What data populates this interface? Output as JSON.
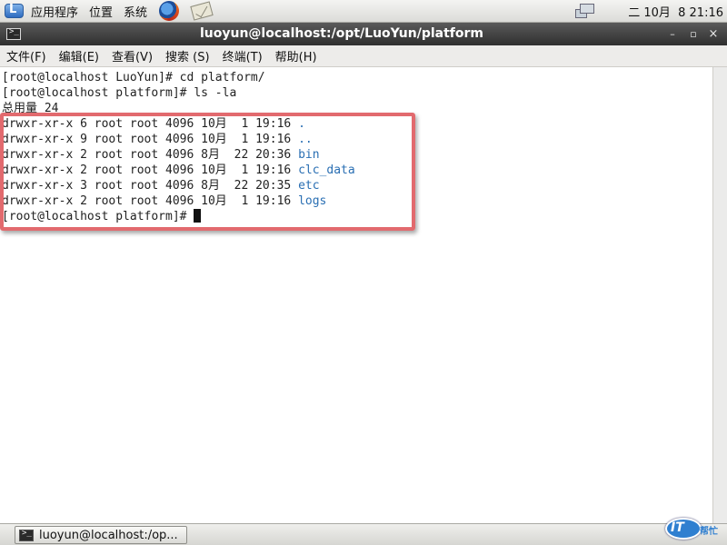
{
  "top_panel": {
    "menus": [
      "应用程序",
      "位置",
      "系统"
    ],
    "clock": "二 10月  8 21:16"
  },
  "window": {
    "title": "luoyun@localhost:/opt/LuoYun/platform",
    "menu": [
      "文件(F)",
      "编辑(E)",
      "查看(V)",
      "搜索 (S)",
      "终端(T)",
      "帮助(H)"
    ]
  },
  "terminal": {
    "lines": [
      {
        "text": "[root@localhost LuoYun]# cd platform/"
      },
      {
        "text": "[root@localhost platform]# ls -la"
      },
      {
        "text": "总用量 24"
      },
      {
        "text": "drwxr-xr-x 6 root root 4096 10月  1 19:16 ",
        "name": "."
      },
      {
        "text": "drwxr-xr-x 9 root root 4096 10月  1 19:16 ",
        "name": ".."
      },
      {
        "text": "drwxr-xr-x 2 root root 4096 8月  22 20:36 ",
        "name": "bin"
      },
      {
        "text": "drwxr-xr-x 2 root root 4096 10月  1 19:16 ",
        "name": "clc_data"
      },
      {
        "text": "drwxr-xr-x 3 root root 4096 8月  22 20:35 ",
        "name": "etc"
      },
      {
        "text": "drwxr-xr-x 2 root root 4096 10月  1 19:16 ",
        "name": "logs"
      }
    ],
    "prompt": "[root@localhost platform]# ",
    "dir_color": "#2a6fb3",
    "highlight_color": "#e26a6e"
  },
  "taskbar": {
    "window_button": "luoyun@localhost:/op..."
  },
  "watermark": {
    "text": "IT",
    "sub": "帮忙"
  },
  "icons": [
    "app-logo-icon",
    "firefox-icon",
    "mail-icon",
    "network-icon",
    "terminal-icon"
  ]
}
